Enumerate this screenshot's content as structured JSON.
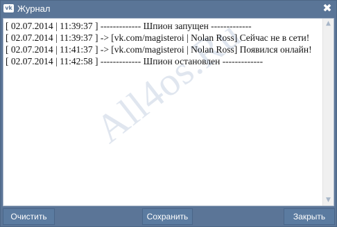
{
  "window": {
    "title": "Журнал",
    "logo_text": "vk",
    "close_glyph": "✖"
  },
  "log": {
    "lines": [
      "[ 02.07.2014 | 11:39:37 ] ------------- Шпион запущен -------------",
      "[ 02.07.2014 | 11:39:37 ] -> [vk.com/magisteroi | Nolan Ross] Сейчас не в сети!",
      "[ 02.07.2014 | 11:41:37 ] -> [vk.com/magisteroi | Nolan Ross] Появился онлайн!",
      "[ 02.07.2014 | 11:42:58 ] ------------- Шпион остановлен -------------"
    ],
    "watermark": "All4os.Ru"
  },
  "scrollbar": {
    "up_glyph": "▲",
    "down_glyph": "▼"
  },
  "buttons": {
    "clear_label": "Очистить",
    "save_label": "Сохранить",
    "close_label": "Закрыть"
  },
  "colors": {
    "titlebar": "#5a7597",
    "button": "#5b7ba0",
    "log_background": "#ffffff"
  }
}
